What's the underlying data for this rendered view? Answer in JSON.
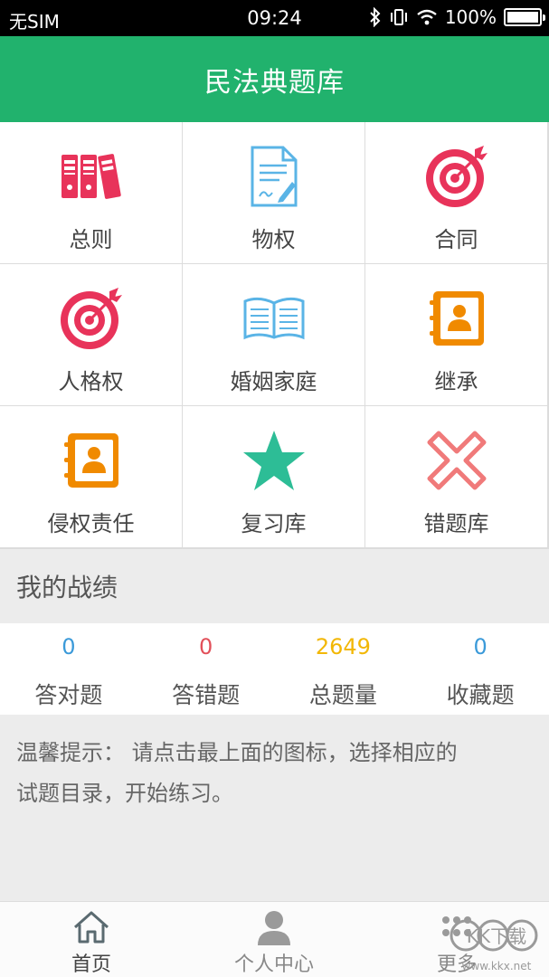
{
  "status": {
    "carrier": "无SIM",
    "time": "09:24",
    "battery": "100%"
  },
  "header": {
    "title": "民法典题库"
  },
  "grid": [
    {
      "label": "总则",
      "icon": "binders-icon"
    },
    {
      "label": "物权",
      "icon": "document-pen-icon"
    },
    {
      "label": "合同",
      "icon": "target-icon"
    },
    {
      "label": "人格权",
      "icon": "target-icon"
    },
    {
      "label": "婚姻家庭",
      "icon": "open-book-icon"
    },
    {
      "label": "继承",
      "icon": "contact-book-icon"
    },
    {
      "label": "侵权责任",
      "icon": "contact-book-icon"
    },
    {
      "label": "复习库",
      "icon": "star-icon"
    },
    {
      "label": "错题库",
      "icon": "cross-icon"
    }
  ],
  "stats_section": {
    "title": "我的战绩"
  },
  "stats": [
    {
      "value": "0",
      "label": "答对题",
      "color": "#3b9ad9"
    },
    {
      "value": "0",
      "label": "答错题",
      "color": "#e2505a"
    },
    {
      "value": "2649",
      "label": "总题量",
      "color": "#f2b705"
    },
    {
      "value": "0",
      "label": "收藏题",
      "color": "#3b9ad9"
    }
  ],
  "tip": {
    "line1": "温馨提示： 请点击最上面的图标，选择相应的",
    "line2": "试题目录，开始练习。"
  },
  "tabs": [
    {
      "label": "首页",
      "icon": "home-icon"
    },
    {
      "label": "个人中心",
      "icon": "person-icon"
    },
    {
      "label": "更多",
      "icon": "more-dots-icon"
    }
  ],
  "watermark": {
    "text": "KK下载",
    "url": "www.kkx.net"
  },
  "colors": {
    "brand": "#21b26d",
    "pink": "#e8335a",
    "orange": "#f08a00",
    "blue": "#5ab4e6",
    "teal": "#2dbd96",
    "red_light": "#f07a7a"
  }
}
